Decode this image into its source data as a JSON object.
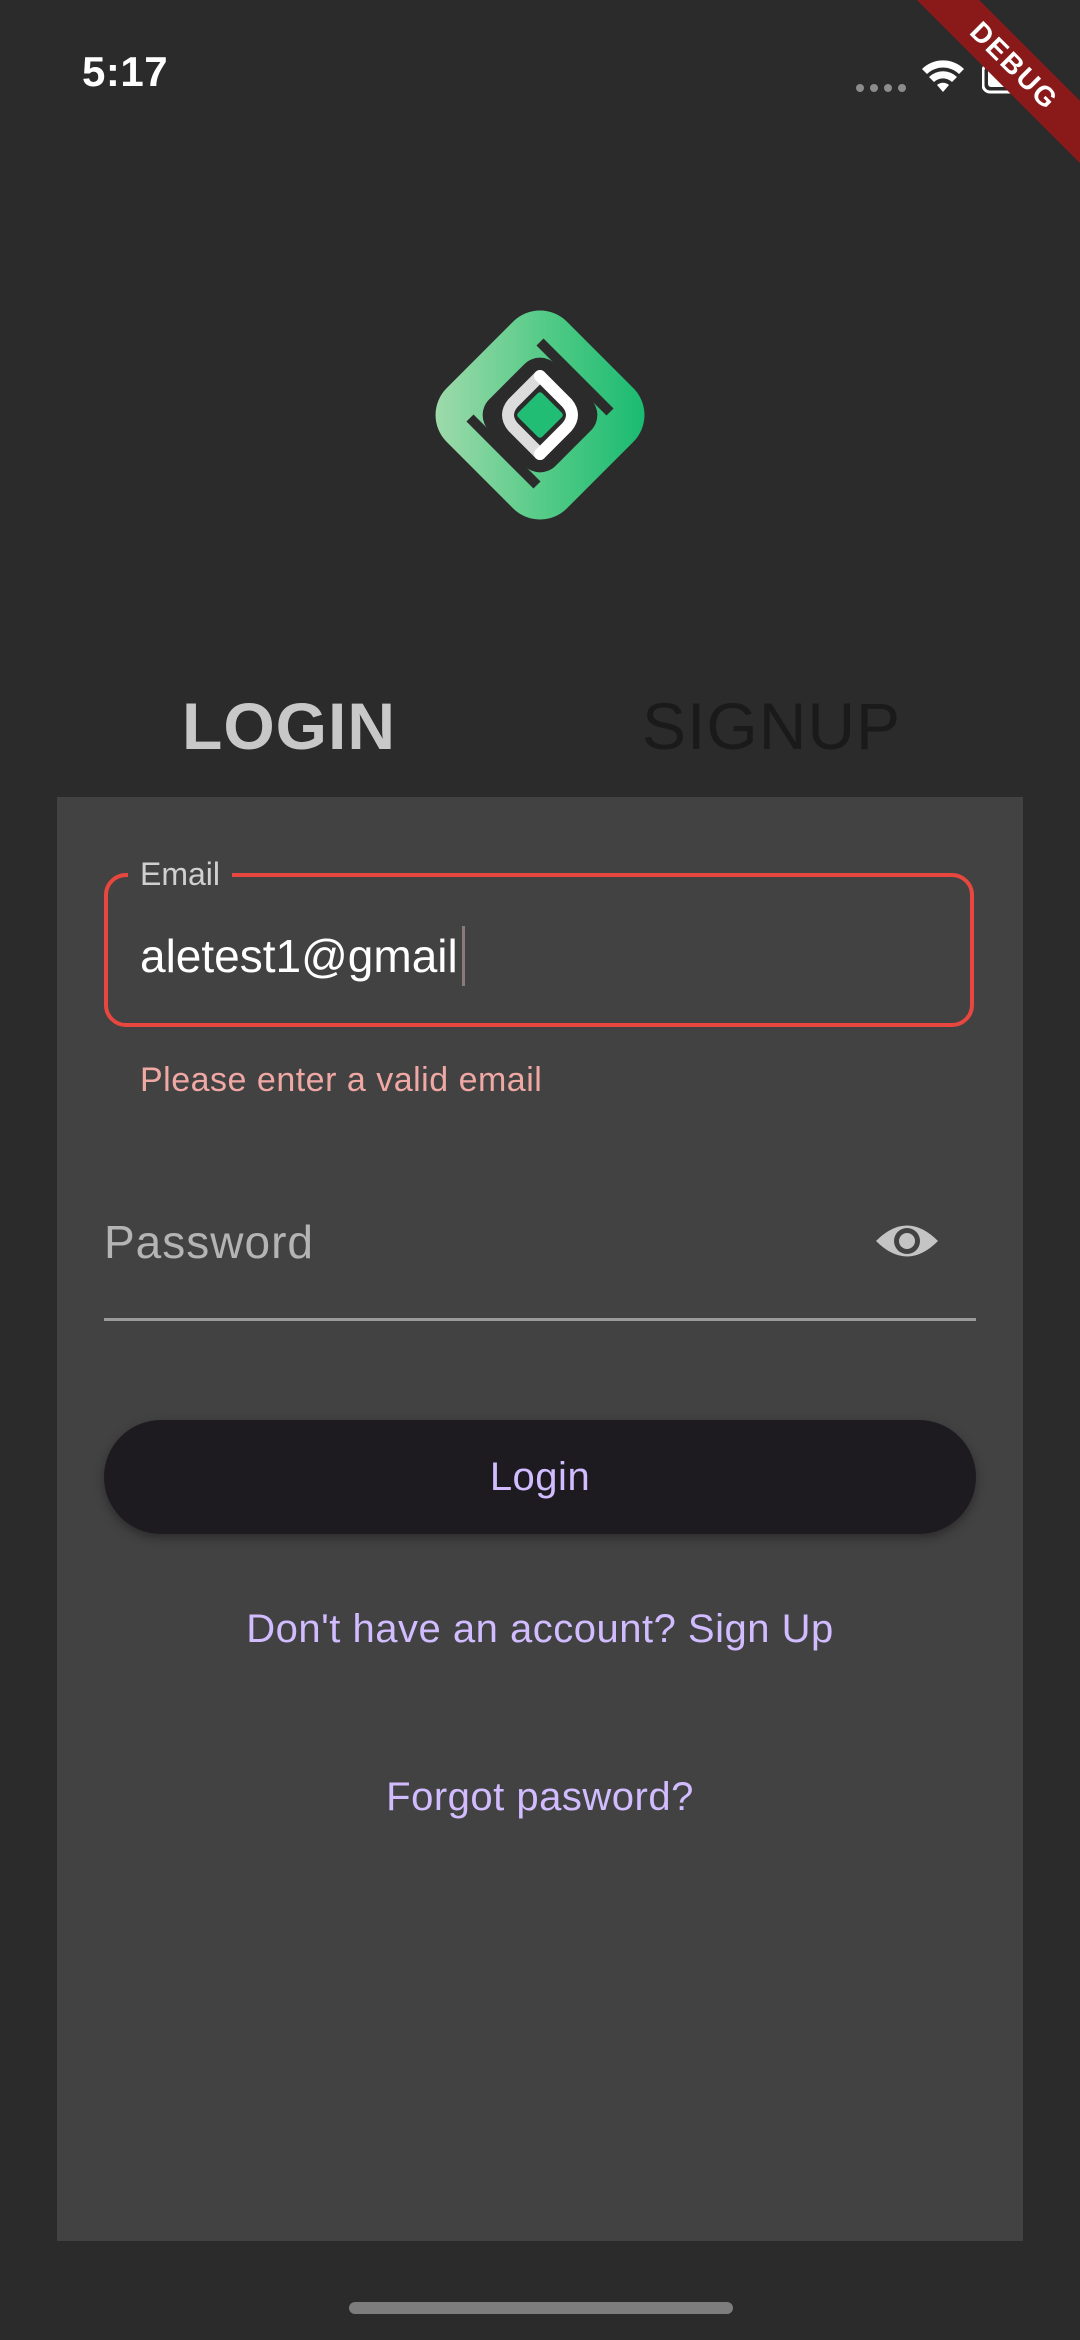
{
  "status_bar": {
    "time": "5:17",
    "icons": [
      "signal-dots-icon",
      "wifi-icon",
      "battery-icon"
    ]
  },
  "debug_banner": {
    "label": "DEBUG",
    "color": "#8a1a1a"
  },
  "logo": {
    "icon": "app-logo-icon",
    "colors": [
      "#1fbf77",
      "#8ed6a3"
    ]
  },
  "tabs": [
    {
      "label": "LOGIN",
      "selected": true
    },
    {
      "label": "SIGNUP",
      "selected": false
    }
  ],
  "form": {
    "email": {
      "label": "Email",
      "value": "aletest1@gmail",
      "error": "Please enter a valid email",
      "error_color": "#e8473f"
    },
    "password": {
      "placeholder": "Password",
      "toggle_icon": "eye-icon"
    },
    "login_button": "Login",
    "signup_link": "Don't have an account? Sign Up",
    "forgot_link": "Forgot pasword?"
  },
  "colors": {
    "background": "#2b2b2b",
    "card": "#424242",
    "accent": "#d1bcff",
    "button": "#1d1b20"
  }
}
